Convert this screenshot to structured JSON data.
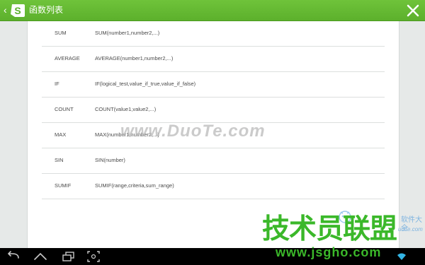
{
  "header": {
    "back_glyph": "‹",
    "title": "函数列表",
    "logo_letter": "S",
    "logo_icon": "app-logo-icon",
    "close_icon": "close-icon"
  },
  "functions": [
    {
      "name": "SUM",
      "syntax": "SUM(number1,number2,...)"
    },
    {
      "name": "AVERAGE",
      "syntax": "AVERAGE(number1,number2,...)"
    },
    {
      "name": "IF",
      "syntax": "IF(logical_test,value_if_true,value_if_false)"
    },
    {
      "name": "COUNT",
      "syntax": "COUNT(value1,value2,...)"
    },
    {
      "name": "MAX",
      "syntax": "MAX(number1,number2,...)"
    },
    {
      "name": "SIN",
      "syntax": "SIN(number)"
    },
    {
      "name": "SUMIF",
      "syntax": "SUMIF(range,criteria,sum_range)"
    }
  ],
  "watermarks": {
    "duote": "www.DuoTe.com",
    "site_logo": "技术员联盟",
    "site_url": "www.jsgho.com",
    "faint_text": "软件大全",
    "faint_text2": "uoTe.com"
  },
  "navbar": {
    "back_icon": "back-icon",
    "home_icon": "home-icon",
    "recent_icon": "recent-apps-icon",
    "screenshot_icon": "screenshot-icon",
    "wifi_icon": "wifi-icon"
  },
  "colors": {
    "titlebar_green": "#5cb02c",
    "watermark_green": "#3bb82a",
    "panel_bg": "#ffffff",
    "page_bg": "#e6e9e8"
  }
}
